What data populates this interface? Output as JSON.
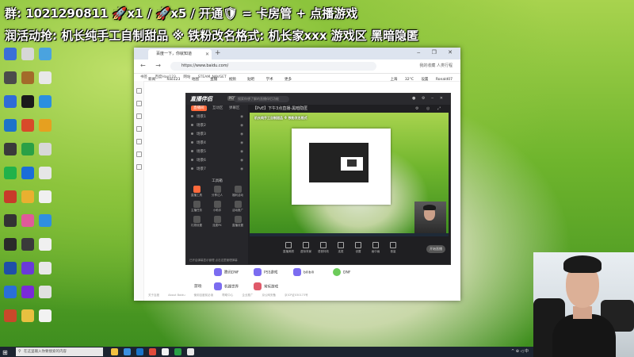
{
  "overlay": {
    "line1": "群: 1021290811 🚀x1 / 🚀x5 / 开通🛡 = 卡房管 + 点播游戏",
    "line2": "润活动抢: 机长纯手工自制甜品 ※ 铁粉改名格式: 机长家xxx 游戏区 黑暗隐匿"
  },
  "desktop_icons": [
    {
      "label": "",
      "color": "#3a6fd8"
    },
    {
      "label": "",
      "color": "#d7d7d7"
    },
    {
      "label": "",
      "color": "#4aa3df"
    },
    {
      "label": "",
      "color": "#4b4b4b"
    },
    {
      "label": "",
      "color": "#a36b2a"
    },
    {
      "label": "",
      "color": "#e8e8e8"
    },
    {
      "label": "",
      "color": "#2f6bd8"
    },
    {
      "label": "",
      "color": "#1a1a1a"
    },
    {
      "label": "",
      "color": "#2a8fe0"
    },
    {
      "label": "",
      "color": "#1e73c9"
    },
    {
      "label": "",
      "color": "#d84a2a"
    },
    {
      "label": "",
      "color": "#e6a020"
    },
    {
      "label": "",
      "color": "#3a3a3a"
    },
    {
      "label": "",
      "color": "#2aa046"
    },
    {
      "label": "",
      "color": "#d8d8d8"
    },
    {
      "label": "",
      "color": "#21b24a"
    },
    {
      "label": "",
      "color": "#1a6ed8"
    },
    {
      "label": "",
      "color": "#e6e6e6"
    },
    {
      "label": "",
      "color": "#c83a2a"
    },
    {
      "label": "",
      "color": "#e9b030"
    },
    {
      "label": "",
      "color": "#f0f0f0"
    },
    {
      "label": "",
      "color": "#333333"
    },
    {
      "label": "",
      "color": "#e05a9a"
    },
    {
      "label": "",
      "color": "#2f8fe0"
    },
    {
      "label": "",
      "color": "#2a2a2a"
    },
    {
      "label": "",
      "color": "#3a3a3a"
    },
    {
      "label": "",
      "color": "#f0f0f0"
    },
    {
      "label": "",
      "color": "#1f4fa8"
    },
    {
      "label": "",
      "color": "#6a3ad8"
    },
    {
      "label": "",
      "color": "#e8e8e8"
    },
    {
      "label": "",
      "color": "#2a6fd8"
    },
    {
      "label": "",
      "color": "#7a2ad8"
    },
    {
      "label": "",
      "color": "#e0e0e0"
    },
    {
      "label": "",
      "color": "#c8482a"
    },
    {
      "label": "",
      "color": "#e8c040"
    },
    {
      "label": "",
      "color": "#f2f2f2"
    }
  ],
  "browser": {
    "tab_title": "百度一下，你就知道",
    "url": "https://www.baidu.com/",
    "bookmarks": [
      "书签",
      "百度Hao123",
      "网站",
      "STEAM_NAVGET"
    ],
    "addr_right": "我的收藏 人类行程",
    "nav_links": [
      "新闻",
      "hao123",
      "地图",
      "直播",
      "视频",
      "贴吧",
      "学术",
      "更多"
    ],
    "right_links": [
      "上海",
      "32°C",
      "设置",
      "Ronald07"
    ],
    "shortcuts": [
      {
        "label": "腾讯DNF",
        "color": "#7b6cf0"
      },
      {
        "label": "PS5游戏",
        "color": "#7b6cf0"
      },
      {
        "label": "bilibili",
        "color": "#7b6cf0"
      },
      {
        "label": "DNF",
        "color": "#6ccb5a"
      },
      {
        "label": "机器世界",
        "color": "#7b6cf0"
      },
      {
        "label": "常玩游戏",
        "color": "#e05a6a"
      }
    ],
    "shortcut_prefix": "游戏:",
    "footer": [
      "关于百度",
      "About Baidu",
      "使用百度前必读",
      "帮助中心",
      "企业推广",
      "京公网安备",
      "京ICP证030173号"
    ]
  },
  "app": {
    "logo": "直播伴侣",
    "badge": "PC版",
    "search_placeholder": "搜索你想了解的直播伴侣功能",
    "stream_title": "【PvE】下午3点直播-黑暗隐匿",
    "left_tabs": [
      "直播间",
      "互动区",
      "弹幕区"
    ],
    "scenes": [
      "场景1",
      "场景2",
      "场景3",
      "场景4",
      "场景5",
      "场景6",
      "场景7"
    ],
    "tools_title": "工具箱",
    "tools": [
      "直播工具",
      "分享达人",
      "福利活动",
      "主播任务",
      "小助手",
      "活动推广",
      "礼物设置",
      "连麦PK",
      "直播设置"
    ],
    "bottom_note": "已开启弹幕显示管理 点击这里管理弹幕",
    "controls": [
      "直播美颜",
      "虚拟背景",
      "语音特效",
      "连麦",
      "设置",
      "画中画",
      "音量"
    ],
    "golive": "开始直播",
    "preview_text": "机长纯手工自制甜品 ※ 铁粉改名格式"
  },
  "taskbar": {
    "search_placeholder": "在这里输入你要搜索的内容",
    "apps": [
      "#f0c040",
      "#3a8fe0",
      "#1a73c8",
      "#e04a3a",
      "#f2f2f2",
      "#2aa046",
      "#e8e8e8"
    ],
    "tray": "^ ⊕ ◁ 中"
  }
}
